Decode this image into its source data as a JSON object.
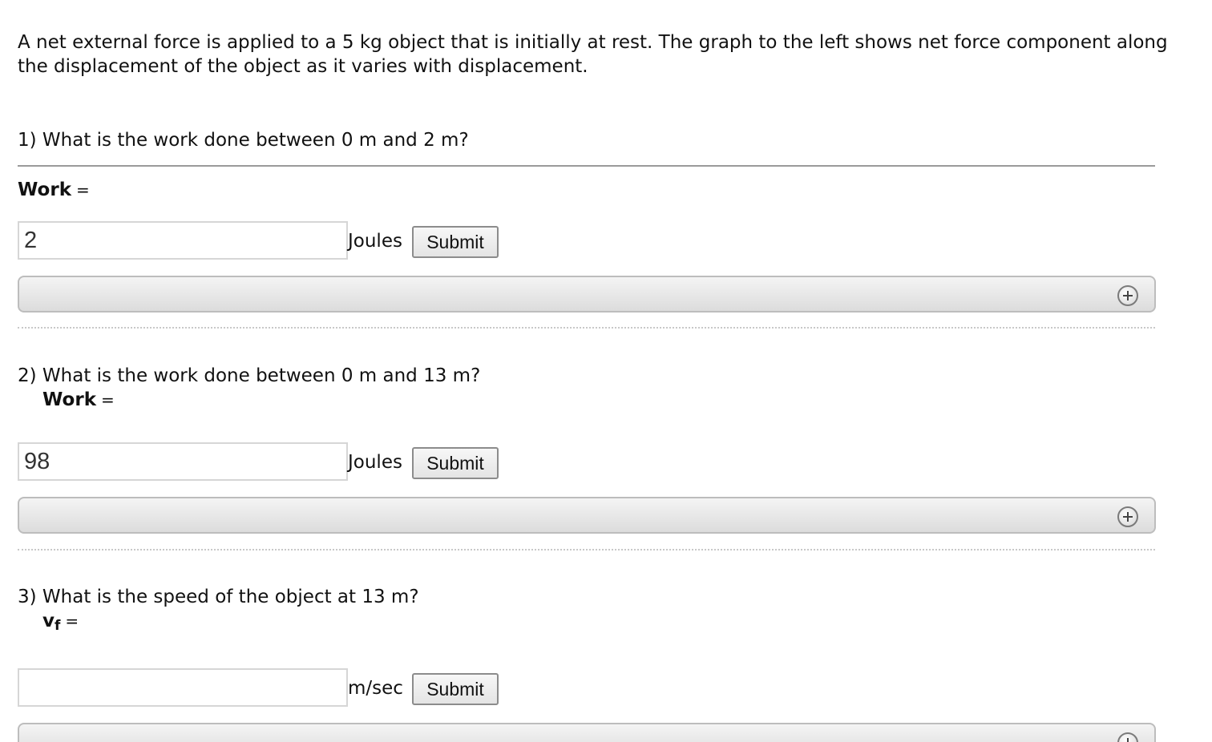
{
  "intro": "A net external force is applied to a 5 kg object that is initially at rest. The graph to the left shows net force component along the displacement of the object as it varies with displacement.",
  "questions": [
    {
      "prompt": "1) What is the work done between 0 m and 2 m?",
      "label": "Work",
      "equals": "=",
      "value": "2",
      "unit": "Joules",
      "submit": "Submit",
      "expander_icon": "plus-circle-icon"
    },
    {
      "prompt": "2) What is the work done between 0 m and 13 m?",
      "label": "Work",
      "equals": "=",
      "value": "98",
      "unit": "Joules",
      "submit": "Submit",
      "expander_icon": "plus-circle-icon"
    },
    {
      "prompt": "3) What is the speed of the object at 13 m?",
      "label": "v",
      "label_sub": "f",
      "equals": "=",
      "value": "",
      "unit": "m/sec",
      "submit": "Submit",
      "expander_icon": "plus-circle-icon"
    }
  ]
}
